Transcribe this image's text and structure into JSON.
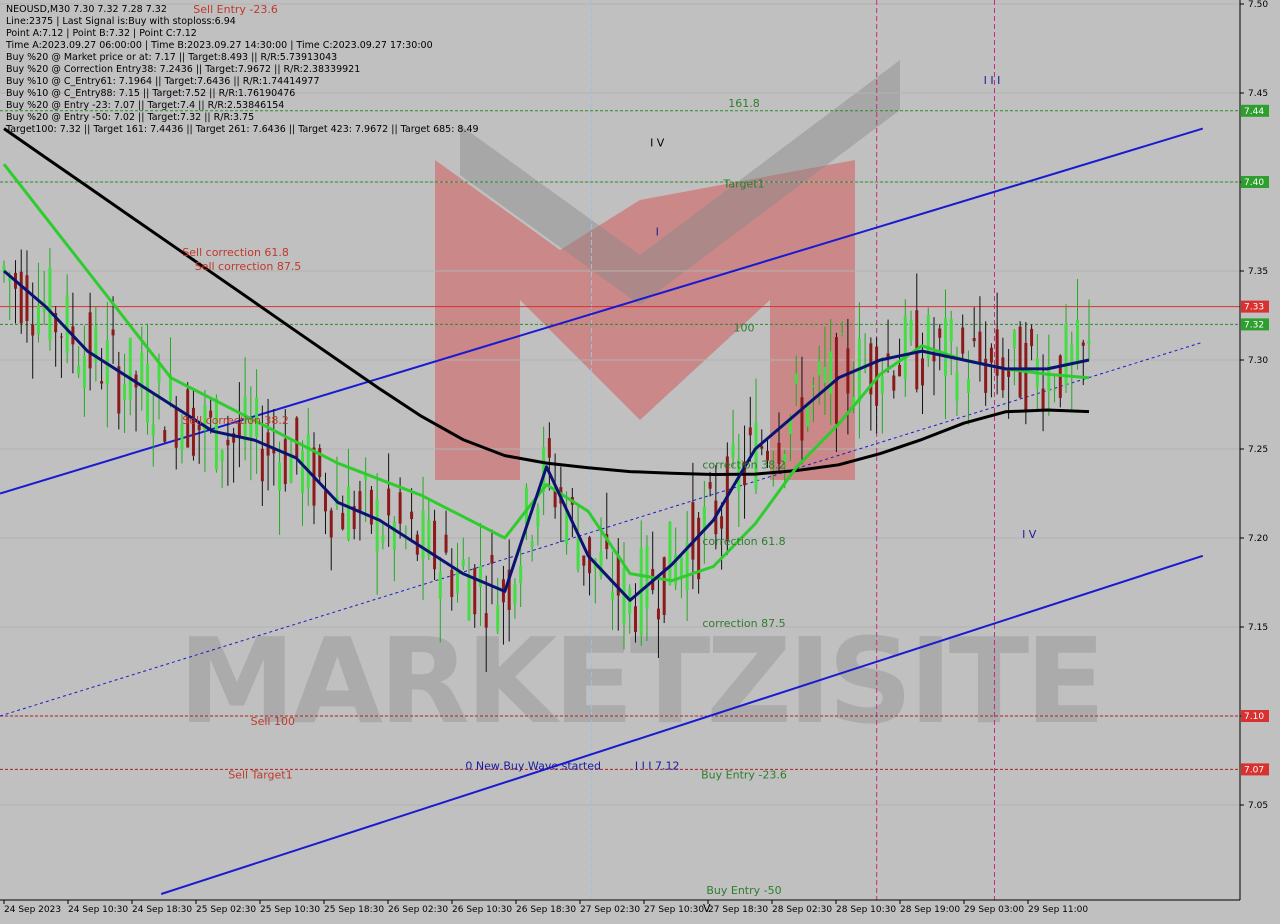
{
  "chart_data": {
    "type": "line",
    "symbol": "NEOUSD,M30",
    "ohlc": "7.30 7.32 7.28 7.32",
    "info_lines": [
      "NEOUSD,M30  7.30 7.32 7.28 7.32",
      "Line:2375 | Last Signal is:Buy with stoploss:6.94",
      "Point A:7.12 | Point B:7.32 | Point C:7.12",
      "Time A:2023.09.27 06:00:00 | Time B:2023.09.27 14:30:00 | Time C:2023.09.27 17:30:00",
      "Buy %20 @ Market price or at: 7.17 || Target:8.493 || R/R:5.73913043",
      "Buy %20 @ Correction Entry38: 7.2436 || Target:7.9672 || R/R:2.38339921",
      "Buy %10 @ C_Entry61: 7.1964 || Target:7.6436 || R/R:1.74414977",
      "Buy %10 @ C_Entry88: 7.15 || Target:7.52 || R/R:1.76190476",
      "Buy %20 @ Entry -23: 7.07 || Target:7.4 || R/R:2.53846154",
      "Buy %20 @ Entry -50: 7.02 || Target:7.32 || R/R:3.75",
      "Target100: 7.32 || Target 161: 7.4436 || Target 261: 7.6436 || Target 423: 7.9672 || Target 685: 8.49"
    ],
    "y_ticks": [
      "7.50",
      "7.45",
      "7.40",
      "7.35",
      "7.30",
      "7.25",
      "7.20",
      "7.15",
      "7.10",
      "7.05"
    ],
    "ylim": [
      7.0,
      7.5
    ],
    "x_ticks": [
      "24 Sep 2023",
      "24 Sep 10:30",
      "24 Sep 18:30",
      "25 Sep 02:30",
      "25 Sep 10:30",
      "25 Sep 18:30",
      "26 Sep 02:30",
      "26 Sep 10:30",
      "26 Sep 18:30",
      "27 Sep 02:30",
      "27 Sep 10:30",
      "27 Sep 18:30",
      "28 Sep 02:30",
      "28 Sep 10:30",
      "28 Sep 19:00",
      "29 Sep 03:00",
      "29 Sep 11:00"
    ],
    "price_boxes": [
      {
        "label": "7.44",
        "value": 7.44,
        "color": "#2e9e2e"
      },
      {
        "label": "7.40",
        "value": 7.4,
        "color": "#2e9e2e"
      },
      {
        "label": "7.33",
        "value": 7.33,
        "color": "#d93030"
      },
      {
        "label": "7.32",
        "value": 7.32,
        "color": "#2e9e2e"
      },
      {
        "label": "7.10",
        "value": 7.1,
        "color": "#d93030"
      },
      {
        "label": "7.07",
        "value": 7.07,
        "color": "#d93030"
      }
    ],
    "levels": [
      {
        "value": 7.44,
        "color": "#2e8b2e",
        "dash": true
      },
      {
        "value": 7.4,
        "color": "#2e8b2e",
        "dash": true
      },
      {
        "value": 7.33,
        "color": "#d93030",
        "dash": false
      },
      {
        "value": 7.32,
        "color": "#2e8b2e",
        "dash": true
      },
      {
        "value": 7.1,
        "color": "#b02020",
        "dash": true
      },
      {
        "value": 7.07,
        "color": "#b02020",
        "dash": true
      }
    ],
    "annotations": [
      {
        "text": "Sell Entry -23.6",
        "x_frac": 0.19,
        "value": 7.495,
        "color": "#c0392b"
      },
      {
        "text": "Sell correction 87.5",
        "x_frac": 0.2,
        "value": 7.3505,
        "color": "#c0392b"
      },
      {
        "text": "Sell correction 61.8",
        "x_frac": 0.19,
        "value": 7.3585,
        "color": "#c0392b"
      },
      {
        "text": "Sell correction 38.2",
        "x_frac": 0.19,
        "value": 7.264,
        "color": "#c0392b"
      },
      {
        "text": "Sell 100",
        "x_frac": 0.22,
        "value": 7.095,
        "color": "#c0392b"
      },
      {
        "text": "Sell Target1",
        "x_frac": 0.21,
        "value": 7.065,
        "color": "#c0392b"
      },
      {
        "text": "161.8",
        "x_frac": 0.6,
        "value": 7.442,
        "color": "#2e7d2e"
      },
      {
        "text": "Target1",
        "x_frac": 0.6,
        "value": 7.397,
        "color": "#2e7d2e"
      },
      {
        "text": "100",
        "x_frac": 0.6,
        "value": 7.316,
        "color": "#2e7d2e"
      },
      {
        "text": "correction 38.2",
        "x_frac": 0.6,
        "value": 7.239,
        "color": "#2e7d2e"
      },
      {
        "text": "correction 61.8",
        "x_frac": 0.6,
        "value": 7.196,
        "color": "#2e7d2e"
      },
      {
        "text": "correction 87.5",
        "x_frac": 0.6,
        "value": 7.15,
        "color": "#2e7d2e"
      },
      {
        "text": "Buy Entry -23.6",
        "x_frac": 0.6,
        "value": 7.065,
        "color": "#2e7d2e"
      },
      {
        "text": "Buy Entry -50",
        "x_frac": 0.6,
        "value": 7.0,
        "color": "#2e7d2e"
      },
      {
        "text": "0 New Buy Wave started",
        "x_frac": 0.43,
        "value": 7.07,
        "color": "#1a1aa0"
      },
      {
        "text": "I I I 7.12",
        "x_frac": 0.53,
        "value": 7.07,
        "color": "#1a1aa0"
      },
      {
        "text": "I V",
        "x_frac": 0.53,
        "value": 7.42,
        "color": "#000"
      },
      {
        "text": "I",
        "x_frac": 0.53,
        "value": 7.37,
        "color": "#1a1aa0"
      },
      {
        "text": "I I I",
        "x_frac": 0.8,
        "value": 7.455,
        "color": "#1a1aa0"
      },
      {
        "text": "I V",
        "x_frac": 0.83,
        "value": 7.2,
        "color": "#1a1aa0"
      },
      {
        "text": "V",
        "x_frac": 0.57,
        "value": 6.99,
        "color": "#000"
      }
    ],
    "watermark": "MARKETZISITE",
    "series": [
      {
        "name": "",
        "color": "#000000",
        "values": [
          7.43,
          7.4137,
          7.3975,
          7.3812,
          7.365,
          7.3487,
          7.3325,
          7.3162,
          7.3,
          7.2838,
          7.2684,
          7.2553,
          7.2463,
          7.2421,
          7.2395,
          7.2373,
          7.2364,
          7.2357,
          7.2359,
          7.2379,
          7.2411,
          7.2474,
          7.2554,
          7.2645,
          7.2709,
          7.2719,
          7.271
        ]
      },
      {
        "name": "",
        "color": "#2ecc2e",
        "values": [
          7.41,
          7.38,
          7.35,
          7.32,
          7.29,
          7.278,
          7.266,
          7.254,
          7.242,
          7.233,
          7.224,
          7.212,
          7.2,
          7.23,
          7.215,
          7.18,
          7.176,
          7.184,
          7.208,
          7.24,
          7.264,
          7.292,
          7.308,
          7.3,
          7.295,
          7.292,
          7.29
        ]
      },
      {
        "name": "",
        "color": "#0a1470",
        "values": [
          7.35,
          7.33,
          7.305,
          7.29,
          7.275,
          7.26,
          7.255,
          7.245,
          7.22,
          7.21,
          7.195,
          7.18,
          7.17,
          7.24,
          7.19,
          7.165,
          7.185,
          7.21,
          7.25,
          7.27,
          7.29,
          7.3,
          7.305,
          7.3,
          7.295,
          7.295,
          7.3
        ]
      }
    ],
    "channel": {
      "color": "#1a1ad0",
      "upper": [
        [
          0.0,
          7.225
        ],
        [
          0.97,
          7.43
        ]
      ],
      "lower": [
        [
          0.13,
          7.0
        ],
        [
          0.97,
          7.19
        ]
      ],
      "mid_dotted": [
        [
          0.0,
          7.1
        ],
        [
          0.97,
          7.31
        ]
      ]
    },
    "vlines": [
      {
        "x_frac": 0.477,
        "color": "#a0c0e0"
      },
      {
        "x_frac": 0.707,
        "color": "#c0307a"
      },
      {
        "x_frac": 0.802,
        "color": "#c0307a"
      }
    ]
  }
}
